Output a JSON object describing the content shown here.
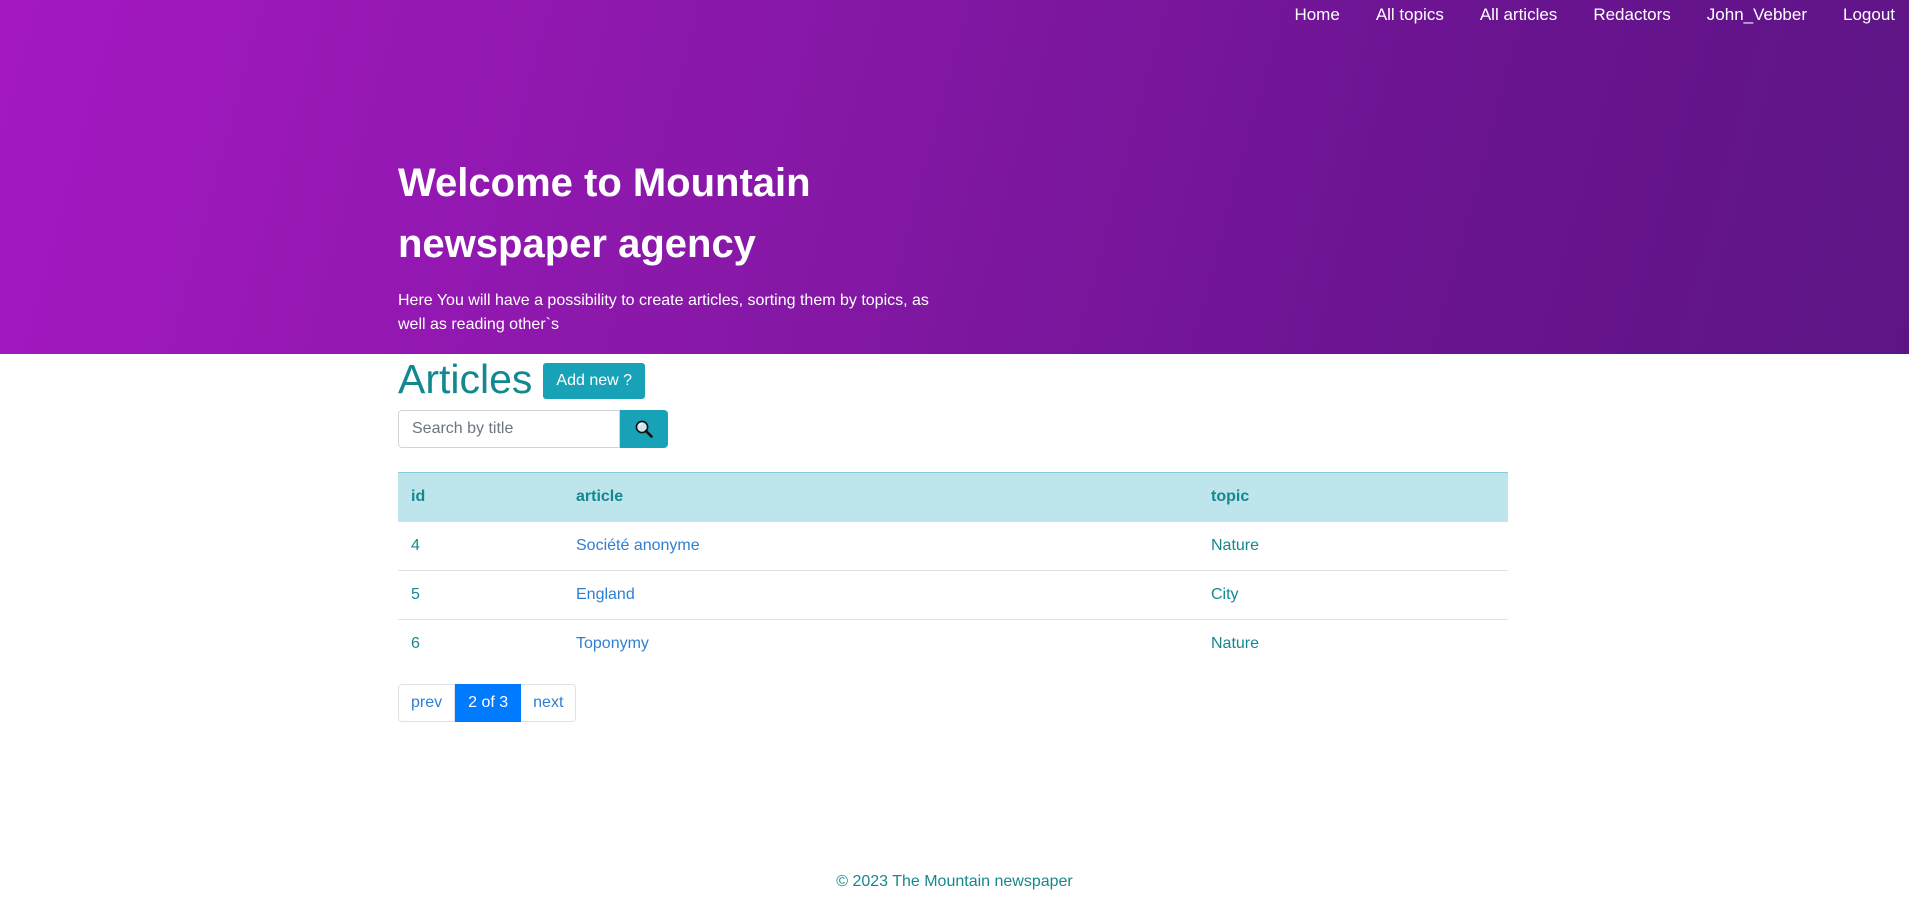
{
  "nav": {
    "items": [
      {
        "label": "Home"
      },
      {
        "label": "All topics"
      },
      {
        "label": "All articles"
      },
      {
        "label": "Redactors"
      },
      {
        "label": "John_Vebber"
      },
      {
        "label": "Logout"
      }
    ]
  },
  "hero": {
    "title_line1": "Welcome to Mountain",
    "title_line2": "newspaper agency",
    "subtitle_line1": "Here You will have a possibility to create articles, sorting them by topics, as",
    "subtitle_line2": "well as reading other`s"
  },
  "articles": {
    "heading": "Articles",
    "add_button": "Add new ?",
    "search": {
      "placeholder": "Search by title",
      "value": "",
      "icon": "search-icon"
    },
    "table": {
      "columns": [
        "id",
        "article",
        "topic"
      ],
      "rows": [
        {
          "id": "4",
          "article": "Société anonyme",
          "topic": "Nature"
        },
        {
          "id": "5",
          "article": "England",
          "topic": "City"
        },
        {
          "id": "6",
          "article": "Toponymy",
          "topic": "Nature"
        }
      ]
    },
    "pagination": {
      "prev": "prev",
      "current": "2 of 3",
      "next": "next"
    }
  },
  "footer": {
    "text": "© 2023 The Mountain newspaper"
  },
  "colors": {
    "hero_gradient_start": "#a418c1",
    "hero_gradient_end": "#5d1585",
    "accent_teal": "#17a2b8",
    "heading_teal": "#14888f",
    "link_blue": "#2f7fd1",
    "pager_active": "#007bff",
    "table_header_bg": "#bee5eb"
  }
}
